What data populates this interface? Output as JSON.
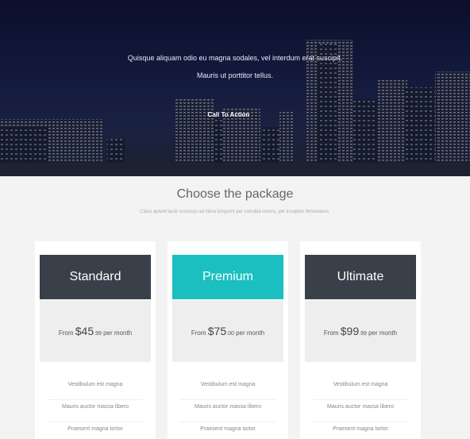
{
  "hero": {
    "line1": "Quisque aliquam odio eu magna sodales, vel interdum erat suscipit.",
    "line2": "Mauris ut porttitor tellus.",
    "cta_label": "Call To Action"
  },
  "section": {
    "title": "Choose the package",
    "subtitle": "Class aptent taciti sociosqu ad litora torquent per conubia nostra, per inceptos himenaeos."
  },
  "plans": [
    {
      "name": "Standard",
      "from": "From",
      "amount": "$45",
      "cents": ".99",
      "period": "per month",
      "features": [
        "Vestibulum est magna",
        "Mauris auctor massa libero",
        "Praesent magna tortor"
      ],
      "header_color": "#394049"
    },
    {
      "name": "Premium",
      "from": "From",
      "amount": "$75",
      "cents": ".00",
      "period": "per month",
      "features": [
        "Vestibulum est magna",
        "Mauris auctor massa libero",
        "Praesent magna tortor"
      ],
      "header_color": "#1bbfbf"
    },
    {
      "name": "Ultimate",
      "from": "From",
      "amount": "$99",
      "cents": ".99",
      "period": "per month",
      "features": [
        "Vestibulum est magna",
        "Mauris auctor massa libero",
        "Praesent magna tortor"
      ],
      "header_color": "#394049"
    }
  ]
}
